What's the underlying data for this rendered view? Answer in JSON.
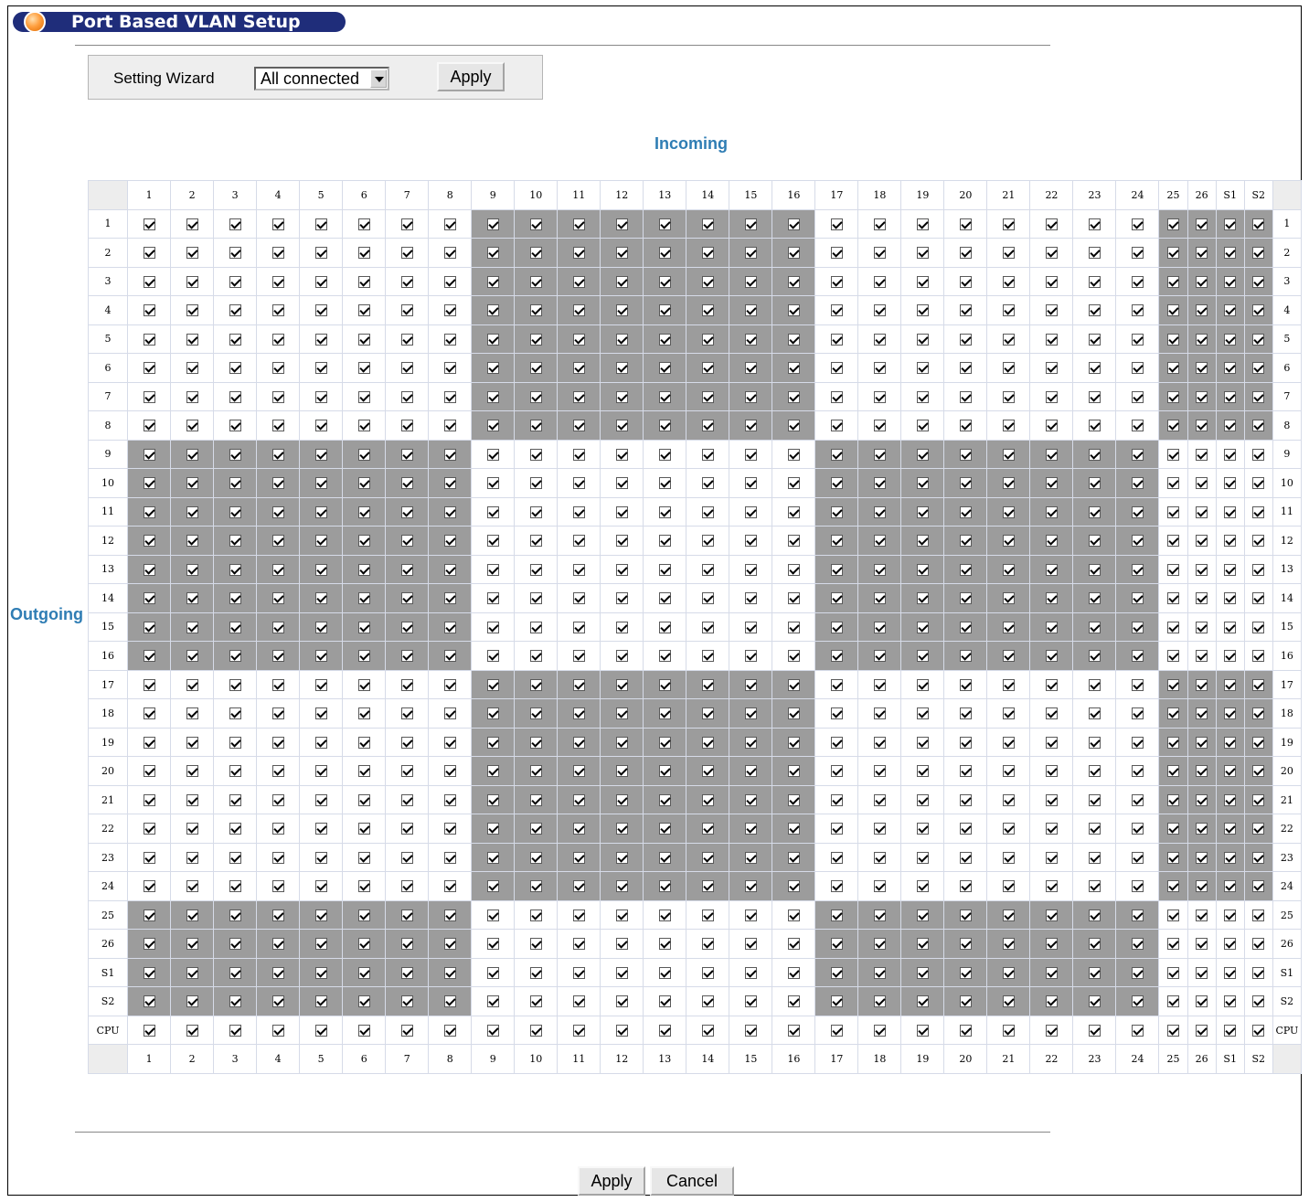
{
  "page": {
    "title": "Port Based VLAN Setup"
  },
  "wizard": {
    "label": "Setting Wizard",
    "selected": "All connected",
    "apply_label": "Apply"
  },
  "matrix": {
    "incoming_label": "Incoming",
    "outgoing_label": "Outgoing",
    "columns": [
      "1",
      "2",
      "3",
      "4",
      "5",
      "6",
      "7",
      "8",
      "9",
      "10",
      "11",
      "12",
      "13",
      "14",
      "15",
      "16",
      "17",
      "18",
      "19",
      "20",
      "21",
      "22",
      "23",
      "24",
      "25",
      "26",
      "S1",
      "S2"
    ],
    "rows": [
      "1",
      "2",
      "3",
      "4",
      "5",
      "6",
      "7",
      "8",
      "9",
      "10",
      "11",
      "12",
      "13",
      "14",
      "15",
      "16",
      "17",
      "18",
      "19",
      "20",
      "21",
      "22",
      "23",
      "24",
      "25",
      "26",
      "S1",
      "S2",
      "CPU"
    ],
    "all_checked": true
  },
  "footer": {
    "apply_label": "Apply",
    "cancel_label": "Cancel"
  }
}
